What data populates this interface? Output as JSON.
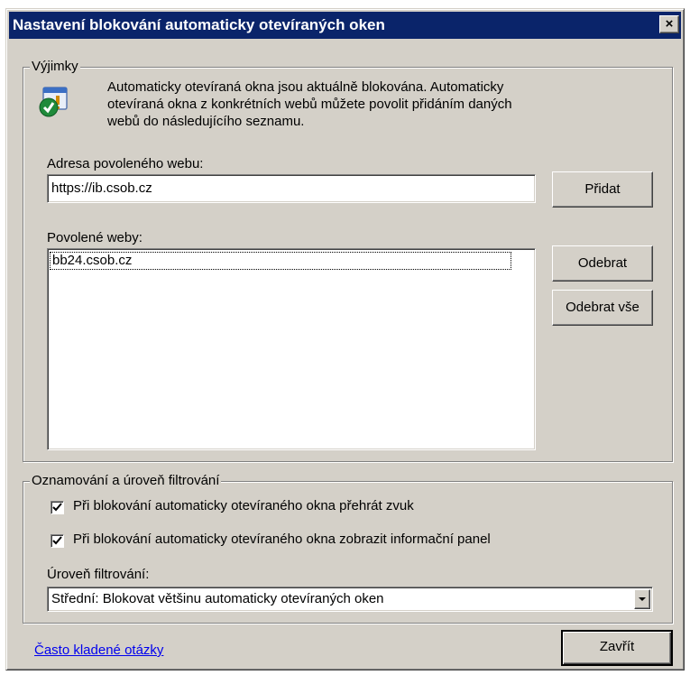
{
  "window": {
    "title": "Nastavení blokování automaticky otevíraných oken",
    "close_glyph": "×"
  },
  "exceptions": {
    "legend": "Výjimky",
    "info_lines": [
      "Automaticky otevíraná okna jsou aktuálně blokována. Automaticky",
      "otevíraná okna z konkrétních webů můžete povolit přidáním daných",
      "webů do následujícího seznamu."
    ],
    "info_icon": "shield-check-icon",
    "address_label": "Adresa povoleného webu:",
    "address_value": "https://ib.csob.cz",
    "add_button": "Přidat",
    "allowed_label": "Povolené weby:",
    "allowed_sites": [
      "bb24.csob.cz"
    ],
    "remove_button": "Odebrat",
    "remove_all_button": "Odebrat vše"
  },
  "notifications": {
    "legend": "Oznamování a úroveň filtrování",
    "play_sound": {
      "label": "Při blokování automaticky otevíraného okna přehrát zvuk",
      "checked": true
    },
    "show_bar": {
      "label": "Při blokování automaticky otevíraného okna zobrazit informační panel",
      "checked": true
    },
    "filter_label": "Úroveň filtrování:",
    "filter_value": "Střední: Blokovat většinu automaticky otevíraných oken"
  },
  "footer": {
    "faq_link": "Často kladené otázky",
    "close_button": "Zavřít"
  },
  "colors": {
    "titlebar": "#0a246a",
    "dialog": "#d4d0c8",
    "link": "#0000ee",
    "check_green": "#1f8a3a"
  }
}
